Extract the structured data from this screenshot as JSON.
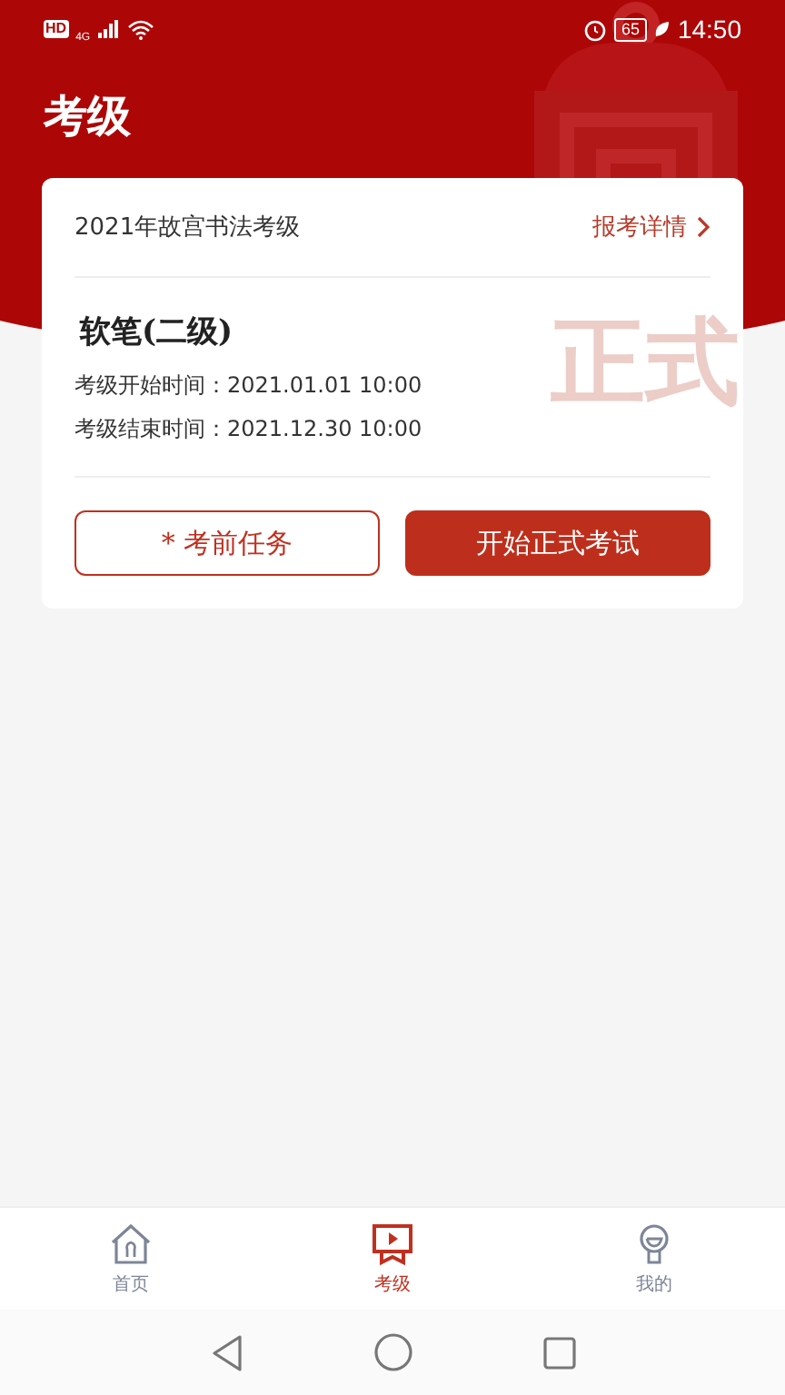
{
  "status_bar": {
    "badges": [
      "HD",
      "4G"
    ],
    "battery": "65",
    "time": "14:50"
  },
  "header": {
    "title": "考级"
  },
  "exam_card": {
    "title": "2021年故宫书法考级",
    "detail_link": "报考详情",
    "level_name": "软笔(二级)",
    "watermark": "正式",
    "times": [
      {
        "label": "考级开始时间：",
        "value": "2021.01.01 10:00"
      },
      {
        "label": "考级结束时间：",
        "value": "2021.12.30 10:00"
      }
    ],
    "buttons": [
      {
        "label": "* 考前任务",
        "kind": "outline"
      },
      {
        "label": "开始正式考试",
        "kind": "filled"
      }
    ]
  },
  "tab_bar": [
    {
      "label": "首页",
      "kind": "home",
      "selected": false
    },
    {
      "label": "考级",
      "kind": "exam",
      "selected": true
    },
    {
      "label": "我的",
      "kind": "profile",
      "selected": false
    }
  ]
}
